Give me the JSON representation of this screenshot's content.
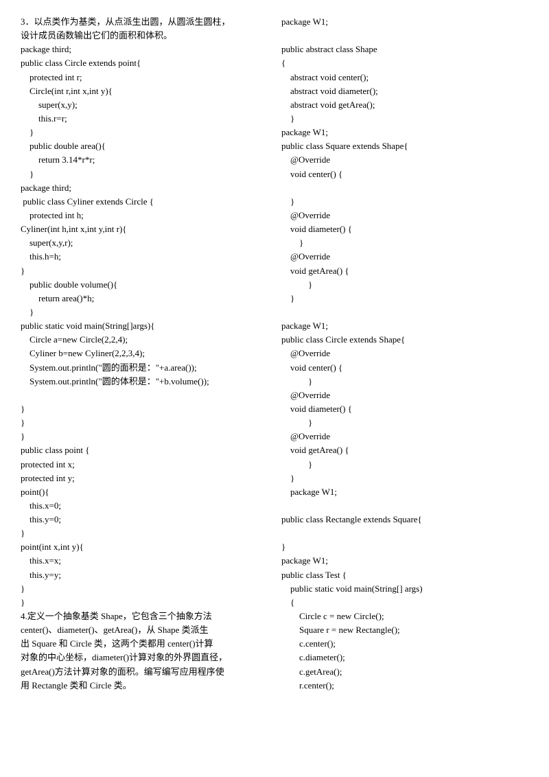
{
  "left": {
    "lines": [
      "3．以点类作为基类，从点派生出圆，从圆派生圆柱，",
      "设计成员函数输出它们的面积和体积。",
      "package third;",
      "public class Circle extends point{",
      "    protected int r;",
      "    Circle(int r,int x,int y){",
      "        super(x,y);",
      "        this.r=r;",
      "    }",
      "    public double area(){",
      "        return 3.14*r*r;",
      "    }",
      "package third;",
      " public class Cyliner extends Circle {",
      "    protected int h;",
      "Cyliner(int h,int x,int y,int r){",
      "    super(x,y,r);",
      "    this.h=h;",
      "}",
      "    public double volume(){",
      "        return area()*h;",
      "    }",
      "public static void main(String[]args){",
      "    Circle a=new Circle(2,2,4);",
      "    Cyliner b=new Cyliner(2,2,3,4);",
      "    System.out.println(\"圆的面积是：\"+a.area());",
      "    System.out.println(\"圆的体积是：\"+b.volume());",
      "",
      "}",
      "}",
      "}",
      "public class point {",
      "protected int x;",
      "protected int y;",
      "point(){",
      "    this.x=0;",
      "    this.y=0;",
      "}",
      "point(int x,int y){",
      "    this.x=x;",
      "    this.y=y;",
      "}",
      "}",
      "4.定义一个抽象基类 Shape，它包含三个抽象方法",
      "center()、diameter()、getArea()，从 Shape 类派生",
      "出 Square 和 Circle 类，这两个类都用 center()计算",
      "对象的中心坐标，diameter()计算对象的外界圆直径，",
      "getArea()方法计算对象的面积。编写编写应用程序使",
      "用 Rectangle 类和 Circle 类。"
    ]
  },
  "right": {
    "lines": [
      "package W1;",
      "",
      "public abstract class Shape",
      "{",
      "    abstract void center();",
      "    abstract void diameter();",
      "    abstract void getArea();",
      "    }",
      "package W1;",
      "public class Square extends Shape{",
      "    @Override",
      "    void center() {",
      "",
      "    }",
      "    @Override",
      "    void diameter() {",
      "        }",
      "    @Override",
      "    void getArea() {",
      "            }",
      "    }",
      "",
      "package W1;",
      "public class Circle extends Shape{",
      "    @Override",
      "    void center() {",
      "            }",
      "    @Override",
      "    void diameter() {",
      "            }",
      "    @Override",
      "    void getArea() {",
      "            }",
      "    }",
      "    package W1;",
      "",
      "public class Rectangle extends Square{",
      "",
      "}",
      "package W1;",
      "public class Test {",
      "    public static void main(String[] args)",
      "    {",
      "        Circle c = new Circle();",
      "        Square r = new Rectangle();",
      "        c.center();",
      "        c.diameter();",
      "        c.getArea();",
      "        r.center();"
    ]
  }
}
